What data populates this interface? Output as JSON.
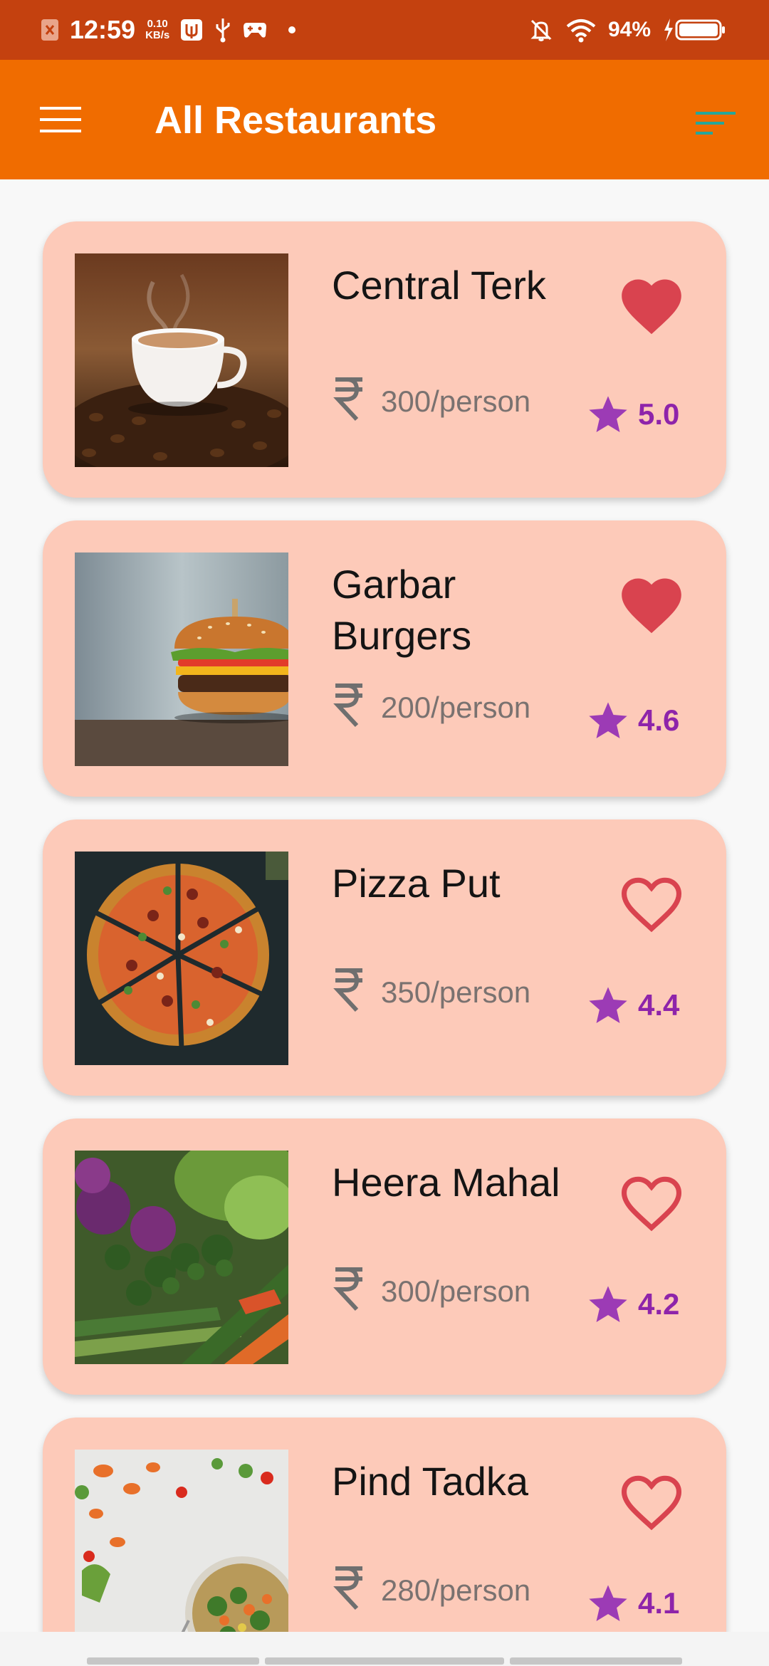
{
  "status_bar": {
    "time": "12:59",
    "speed_value": "0.10",
    "speed_unit": "KB/s",
    "battery": "94%"
  },
  "app_bar": {
    "title": "All Restaurants"
  },
  "colors": {
    "status_bar": "#c4410f",
    "app_bar": "#f06c00",
    "card": "#fdcab9",
    "heart": "#d9434f",
    "rating": "#8e24aa",
    "filter_icon": "#26a69a"
  },
  "restaurants": [
    {
      "name": "Central Terk",
      "price": "300/person",
      "rating": "5.0",
      "favorite": true,
      "image": "coffee-cup"
    },
    {
      "name": "Garbar Burgers",
      "price": "200/person",
      "rating": "4.6",
      "favorite": true,
      "image": "burger"
    },
    {
      "name": "Pizza Put",
      "price": "350/person",
      "rating": "4.4",
      "favorite": false,
      "image": "pizza"
    },
    {
      "name": "Heera Mahal",
      "price": "300/person",
      "rating": "4.2",
      "favorite": false,
      "image": "vegetables"
    },
    {
      "name": "Pind Tadka",
      "price": "280/person",
      "rating": "4.1",
      "favorite": false,
      "image": "salad-bowl"
    }
  ]
}
